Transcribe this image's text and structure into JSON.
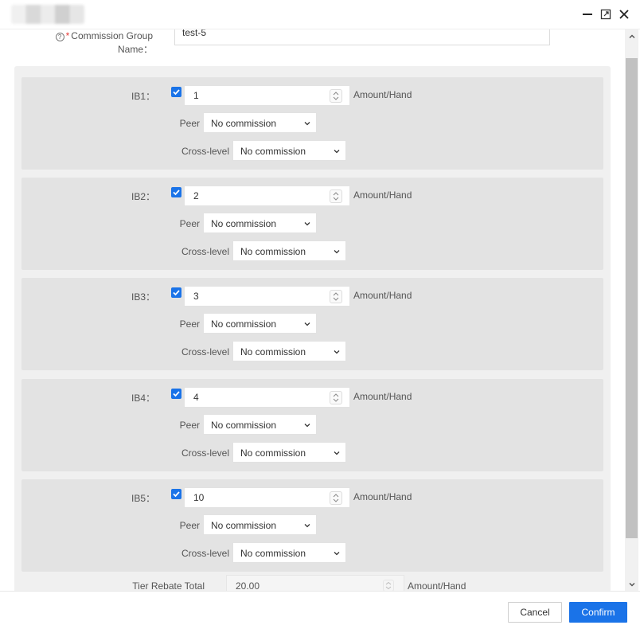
{
  "window": {
    "controls": [
      "minimize-icon",
      "maximize-icon",
      "close-icon"
    ]
  },
  "form": {
    "group_name_label": "Commission Group Name：",
    "group_name_value": "test-5",
    "required_mark": "*",
    "help_mark": "?"
  },
  "ib_levels": [
    {
      "label": "IB1：",
      "checked": true,
      "value": "1",
      "unit": "Amount/Hand",
      "peer_label": "Peer",
      "peer_value": "No commission",
      "cross_label": "Cross-level",
      "cross_value": "No commission"
    },
    {
      "label": "IB2：",
      "checked": true,
      "value": "2",
      "unit": "Amount/Hand",
      "peer_label": "Peer",
      "peer_value": "No commission",
      "cross_label": "Cross-level",
      "cross_value": "No commission"
    },
    {
      "label": "IB3：",
      "checked": true,
      "value": "3",
      "unit": "Amount/Hand",
      "peer_label": "Peer",
      "peer_value": "No commission",
      "cross_label": "Cross-level",
      "cross_value": "No commission"
    },
    {
      "label": "IB4：",
      "checked": true,
      "value": "4",
      "unit": "Amount/Hand",
      "peer_label": "Peer",
      "peer_value": "No commission",
      "cross_label": "Cross-level",
      "cross_value": "No commission"
    },
    {
      "label": "IB5：",
      "checked": true,
      "value": "10",
      "unit": "Amount/Hand",
      "peer_label": "Peer",
      "peer_value": "No commission",
      "cross_label": "Cross-level",
      "cross_value": "No commission"
    }
  ],
  "total": {
    "label": "Tier Rebate Total",
    "value": "20.00",
    "unit": "Amount/Hand"
  },
  "footer": {
    "cancel_label": "Cancel",
    "confirm_label": "Confirm"
  },
  "colors": {
    "accent": "#1a73e8",
    "panel_bg": "#f0f0f0",
    "block_bg": "#e3e3e3"
  }
}
